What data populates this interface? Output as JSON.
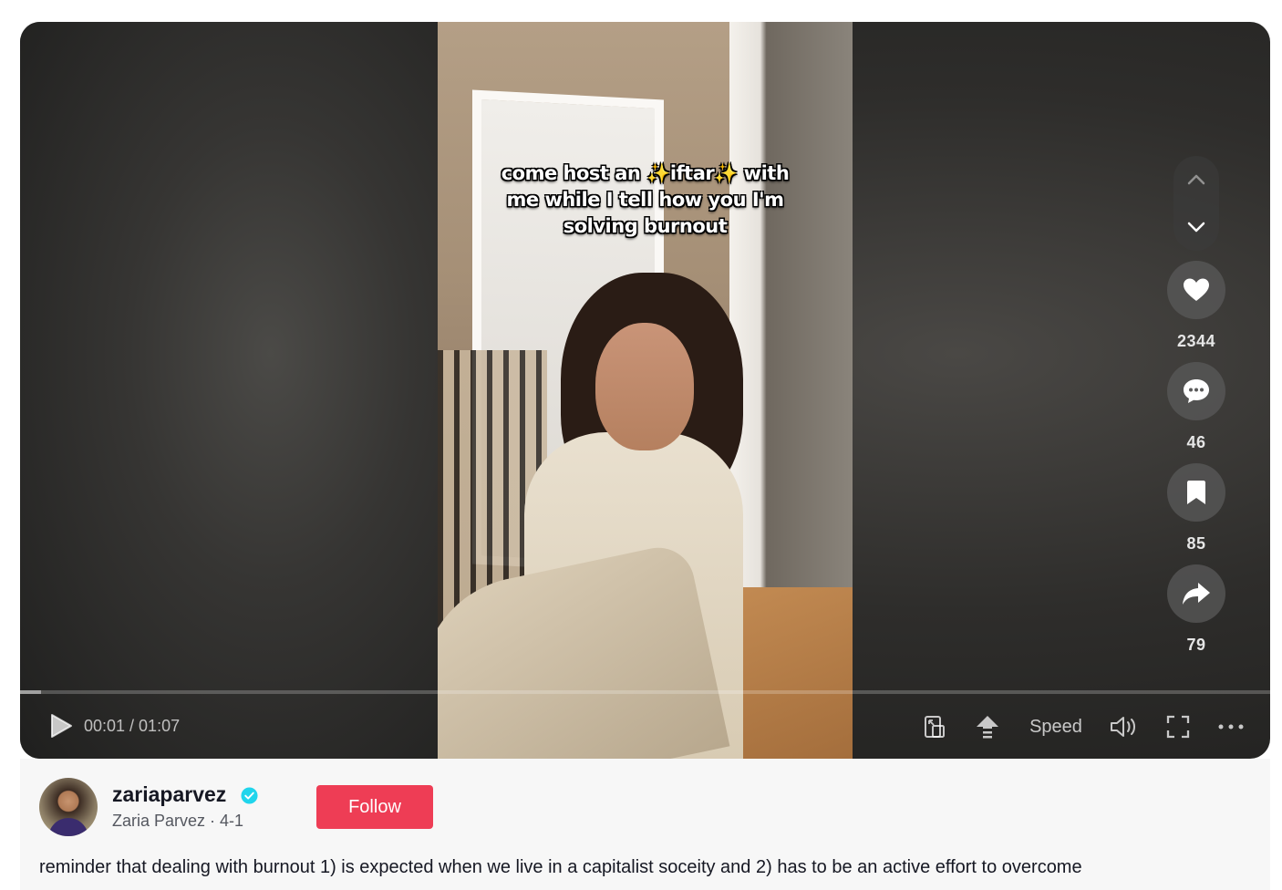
{
  "video": {
    "caption_line1": "come host an ✨iftar✨ with",
    "caption_line2": "me while I tell how you I'm",
    "caption_line3": "solving burnout"
  },
  "navigation": {
    "prev_icon": "chevron-up-icon",
    "next_icon": "chevron-down-icon"
  },
  "actions": {
    "likes": "2344",
    "comments": "46",
    "saves": "85",
    "shares": "79"
  },
  "controls": {
    "time": "00:01 / 01:07",
    "progress_fraction": 0.017,
    "speed_label": "Speed"
  },
  "author": {
    "username": "zariaparvez",
    "display_line": "Zaria Parvez · 4-1",
    "follow_label": "Follow"
  },
  "description": "reminder that dealing with burnout 1) is expected when we live in a capitalist soceity and 2) has to be an active effort to overcome",
  "colors": {
    "follow_button": "#ee3d55",
    "verified_badge": "#20d5ec"
  }
}
